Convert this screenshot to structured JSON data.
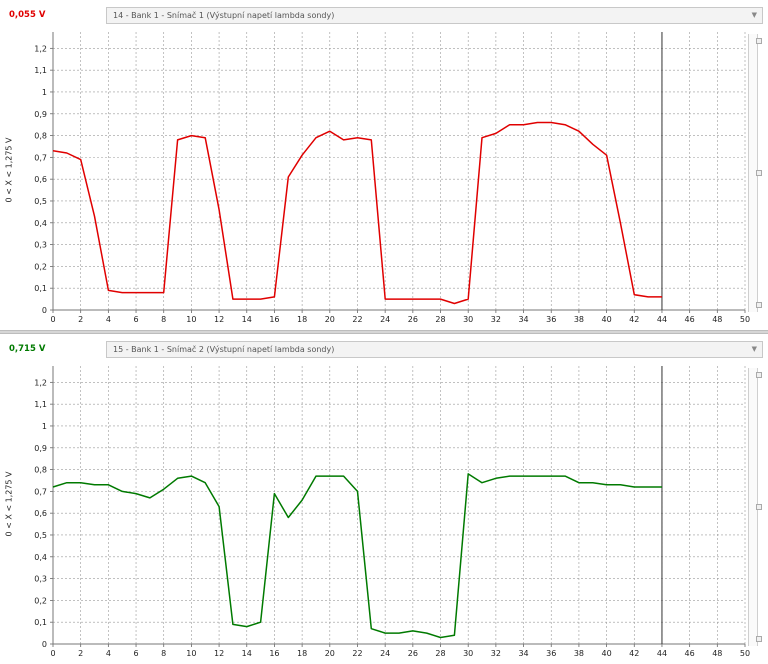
{
  "panels": [
    {
      "readout": "0,055 V",
      "readout_color": "#e00000",
      "channel_label": "14 - Bank 1 - Snímač 1 (Výstupní napetí lambda sondy)",
      "y_title": "0  < X <  1,275 V"
    },
    {
      "readout": "0,715 V",
      "readout_color": "#007a00",
      "channel_label": "15 - Bank 1 - Snímač 2 (Výstupní napetí lambda sondy)",
      "y_title": "0  < X <  1,275 V"
    }
  ],
  "chart_data": [
    {
      "type": "line",
      "color": "#e00000",
      "xlim": [
        0,
        50
      ],
      "ylim": [
        0,
        1.275
      ],
      "cursor_x": 44,
      "grid": true,
      "x_ticks": [
        "0",
        "2",
        "4",
        "6",
        "8",
        "10",
        "12",
        "14",
        "16",
        "18",
        "20",
        "22",
        "24",
        "26",
        "28",
        "30",
        "32",
        "34",
        "36",
        "38",
        "40",
        "42",
        "44",
        "46",
        "48",
        "50"
      ],
      "y_ticks": [
        "0",
        "0,1",
        "0,2",
        "0,3",
        "0,4",
        "0,5",
        "0,6",
        "0,7",
        "0,8",
        "0,9",
        "1",
        "1,1",
        "1,2"
      ],
      "series": [
        {
          "x": [
            0,
            1,
            2,
            3,
            4,
            5,
            6,
            7,
            8,
            9,
            10,
            11,
            12,
            13,
            14,
            15,
            16,
            17,
            18,
            19,
            20,
            21,
            22,
            23,
            24,
            25,
            26,
            27,
            28,
            29,
            30,
            31,
            32,
            33,
            34,
            35,
            36,
            37,
            38,
            39,
            40,
            41,
            42,
            43,
            44
          ],
          "y": [
            0.73,
            0.72,
            0.69,
            0.43,
            0.09,
            0.08,
            0.08,
            0.08,
            0.08,
            0.78,
            0.8,
            0.79,
            0.46,
            0.05,
            0.05,
            0.05,
            0.06,
            0.61,
            0.71,
            0.79,
            0.82,
            0.78,
            0.79,
            0.78,
            0.05,
            0.05,
            0.05,
            0.05,
            0.05,
            0.03,
            0.05,
            0.79,
            0.81,
            0.85,
            0.85,
            0.86,
            0.86,
            0.85,
            0.82,
            0.76,
            0.71,
            0.4,
            0.07,
            0.06,
            0.06
          ]
        }
      ]
    },
    {
      "type": "line",
      "color": "#007a00",
      "xlim": [
        0,
        50
      ],
      "ylim": [
        0,
        1.275
      ],
      "cursor_x": 44,
      "grid": true,
      "x_ticks": [
        "0",
        "2",
        "4",
        "6",
        "8",
        "10",
        "12",
        "14",
        "16",
        "18",
        "20",
        "22",
        "24",
        "26",
        "28",
        "30",
        "32",
        "34",
        "36",
        "38",
        "40",
        "42",
        "44",
        "46",
        "48",
        "50"
      ],
      "y_ticks": [
        "0",
        "0,1",
        "0,2",
        "0,3",
        "0,4",
        "0,5",
        "0,6",
        "0,7",
        "0,8",
        "0,9",
        "1",
        "1,1",
        "1,2"
      ],
      "series": [
        {
          "x": [
            0,
            1,
            2,
            3,
            4,
            5,
            6,
            7,
            8,
            9,
            10,
            11,
            12,
            13,
            14,
            15,
            16,
            17,
            18,
            19,
            20,
            21,
            22,
            23,
            24,
            25,
            26,
            27,
            28,
            29,
            30,
            31,
            32,
            33,
            34,
            35,
            36,
            37,
            38,
            39,
            40,
            41,
            42,
            43,
            44
          ],
          "y": [
            0.72,
            0.74,
            0.74,
            0.73,
            0.73,
            0.7,
            0.69,
            0.67,
            0.71,
            0.76,
            0.77,
            0.74,
            0.63,
            0.09,
            0.08,
            0.1,
            0.69,
            0.58,
            0.66,
            0.77,
            0.77,
            0.77,
            0.7,
            0.07,
            0.05,
            0.05,
            0.06,
            0.05,
            0.03,
            0.04,
            0.78,
            0.74,
            0.76,
            0.77,
            0.77,
            0.77,
            0.77,
            0.77,
            0.74,
            0.74,
            0.73,
            0.73,
            0.72,
            0.72,
            0.72
          ]
        }
      ]
    }
  ]
}
